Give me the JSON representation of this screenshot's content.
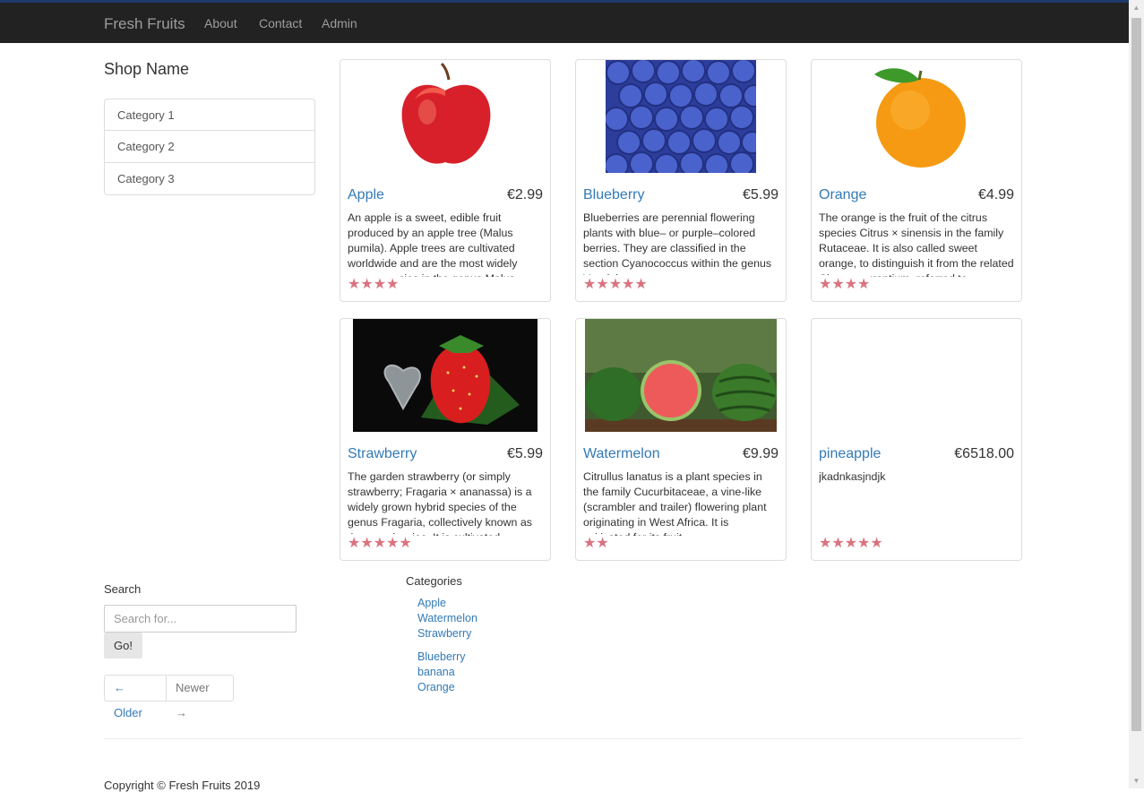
{
  "navbar": {
    "brand": "Fresh Fruits",
    "links": [
      "About",
      "Contact",
      "Admin"
    ]
  },
  "sidebar": {
    "shop_name": "Shop Name",
    "categories": [
      "Category 1",
      "Category 2",
      "Category 3"
    ]
  },
  "products": [
    {
      "name": "Apple",
      "price": "€2.99",
      "description": "An apple is a sweet, edible fruit produced by an apple tree (Malus pumila). Apple trees are cultivated worldwide and are the most widely grown species in the genus Malus.",
      "rating": 4,
      "stars": "★★★★"
    },
    {
      "name": "Blueberry",
      "price": "€5.99",
      "description": "Blueberries are perennial flowering plants with blue– or purple–colored berries. They are classified in the section Cyanococcus within the genus Vaccinium.",
      "rating": 5,
      "stars": "★★★★★"
    },
    {
      "name": "Orange",
      "price": "€4.99",
      "description": "The orange is the fruit of the citrus species Citrus × sinensis in the family Rutaceae. It is also called sweet orange, to distinguish it from the related Citrus × aurantium, referred to",
      "rating": 4,
      "stars": "★★★★"
    },
    {
      "name": "Strawberry",
      "price": "€5.99",
      "description": "The garden strawberry (or simply strawberry; Fragaria × ananassa) is a widely grown hybrid species of the genus Fragaria, collectively known as the strawberries. It is cultivated",
      "rating": 5,
      "stars": "★★★★★"
    },
    {
      "name": "Watermelon",
      "price": "€9.99",
      "description": "Citrullus lanatus is a plant species in the family Cucurbitaceae, a vine-like (scrambler and trailer) flowering plant originating in West Africa. It is cultivated for its fruit.",
      "rating": 2,
      "stars": "★★"
    },
    {
      "name": "pineapple",
      "price": "€6518.00",
      "description": "jkadnkasjndjk",
      "rating": 5,
      "stars": "★★★★★"
    }
  ],
  "search": {
    "label": "Search",
    "placeholder": "Search for...",
    "button": "Go!"
  },
  "pager": {
    "older": "← Older",
    "newer": "Newer →"
  },
  "footer_categories": {
    "title": "Categories",
    "column1": [
      "Apple",
      "Watermelon",
      "Strawberry"
    ],
    "column2": [
      "Blueberry",
      "banana",
      "Orange"
    ]
  },
  "footer": {
    "copyright": "Copyright © Fresh Fruits 2019"
  },
  "colors": {
    "navbar_bg": "#222222",
    "link": "#337ab7",
    "star": "#d9737f"
  },
  "icons": {
    "rating": "star-icon",
    "scroll_up": "scroll-up-arrow-icon",
    "scroll_down": "scroll-down-arrow-icon"
  }
}
